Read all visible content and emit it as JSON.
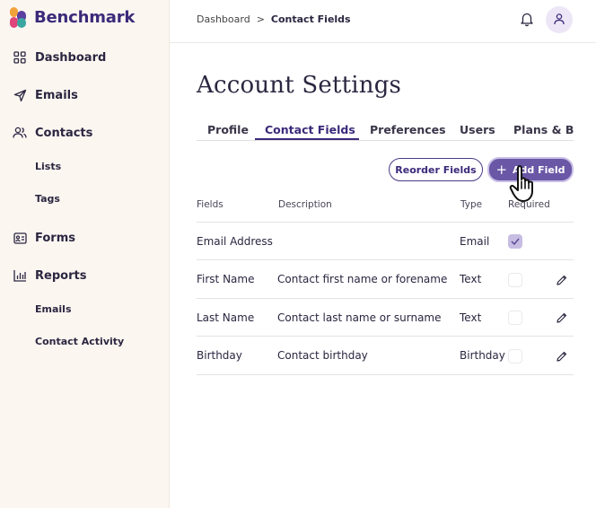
{
  "brand": {
    "name": "Benchmark"
  },
  "sidebar": {
    "items": [
      {
        "label": "Dashboard",
        "icon": "grid-icon"
      },
      {
        "label": "Emails",
        "icon": "paper-plane-icon"
      },
      {
        "label": "Contacts",
        "icon": "users-icon"
      },
      {
        "label": "Forms",
        "icon": "id-card-icon"
      },
      {
        "label": "Reports",
        "icon": "bar-chart-icon"
      }
    ],
    "contacts_sub": [
      "Lists",
      "Tags"
    ],
    "reports_sub": [
      "Emails",
      "Contact Activity"
    ]
  },
  "header": {
    "breadcrumb_root": "Dashboard",
    "breadcrumb_sep": ">",
    "breadcrumb_current": "Contact Fields"
  },
  "page": {
    "title": "Account Settings",
    "tabs": [
      "Profile",
      "Contact Fields",
      "Preferences",
      "Users",
      "Plans & Billing"
    ],
    "active_tab": "Contact Fields"
  },
  "actions": {
    "reorder_label": "Reorder Fields",
    "add_label": "Add Field",
    "add_prefix": "+"
  },
  "table": {
    "headers": [
      "Fields",
      "Description",
      "Type",
      "Required"
    ],
    "rows": [
      {
        "field": "Email Address",
        "description": "",
        "type": "Email",
        "required": true,
        "editable": false
      },
      {
        "field": "First Name",
        "description": "Contact first name or forename",
        "type": "Text",
        "required": false,
        "editable": true
      },
      {
        "field": "Last Name",
        "description": "Contact last name or surname",
        "type": "Text",
        "required": false,
        "editable": true
      },
      {
        "field": "Birthday",
        "description": "Contact birthday",
        "type": "Birthday",
        "required": false,
        "editable": true
      }
    ]
  },
  "colors": {
    "brand": "#3b2a7a",
    "primary_button": "#6a57a6",
    "sidebar_bg": "#fcf6f1",
    "checkbox_checked": "#c7bde3"
  }
}
